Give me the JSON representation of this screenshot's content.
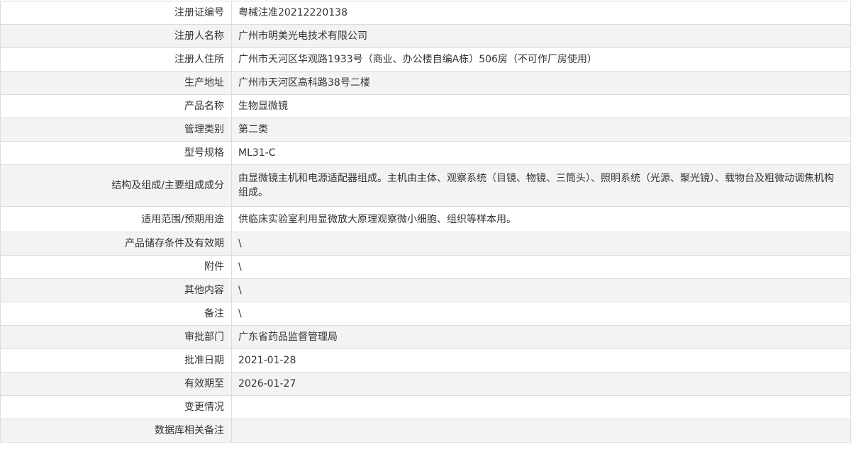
{
  "record": {
    "rows": [
      {
        "label": "注册证编号",
        "value": "粤械注准20212220138"
      },
      {
        "label": "注册人名称",
        "value": "广州市明美光电技术有限公司"
      },
      {
        "label": "注册人住所",
        "value": "广州市天河区华观路1933号（商业、办公楼自编A栋）506房（不可作厂房使用）"
      },
      {
        "label": "生产地址",
        "value": "广州市天河区高科路38号二楼"
      },
      {
        "label": "产品名称",
        "value": "生物显微镜"
      },
      {
        "label": "管理类别",
        "value": "第二类"
      },
      {
        "label": "型号规格",
        "value": "ML31-C"
      },
      {
        "label": "结构及组成/主要组成成分",
        "value": "由显微镜主机和电源适配器组成。主机由主体、观察系统（目镜、物镜、三筒头）、照明系统（光源、聚光镜）、载物台及粗微动调焦机构组成。"
      },
      {
        "label": "适用范围/预期用途",
        "value": "供临床实验室利用显微放大原理观察微小细胞、组织等样本用。"
      },
      {
        "label": "产品储存条件及有效期",
        "value": "\\"
      },
      {
        "label": "附件",
        "value": "\\"
      },
      {
        "label": "其他内容",
        "value": "\\"
      },
      {
        "label": "备注",
        "value": "\\"
      },
      {
        "label": "审批部门",
        "value": "广东省药品监督管理局"
      },
      {
        "label": "批准日期",
        "value": "2021-01-28"
      },
      {
        "label": "有效期至",
        "value": "2026-01-27"
      },
      {
        "label": "变更情况",
        "value": ""
      },
      {
        "label": "数据库相关备注",
        "value": ""
      }
    ]
  }
}
